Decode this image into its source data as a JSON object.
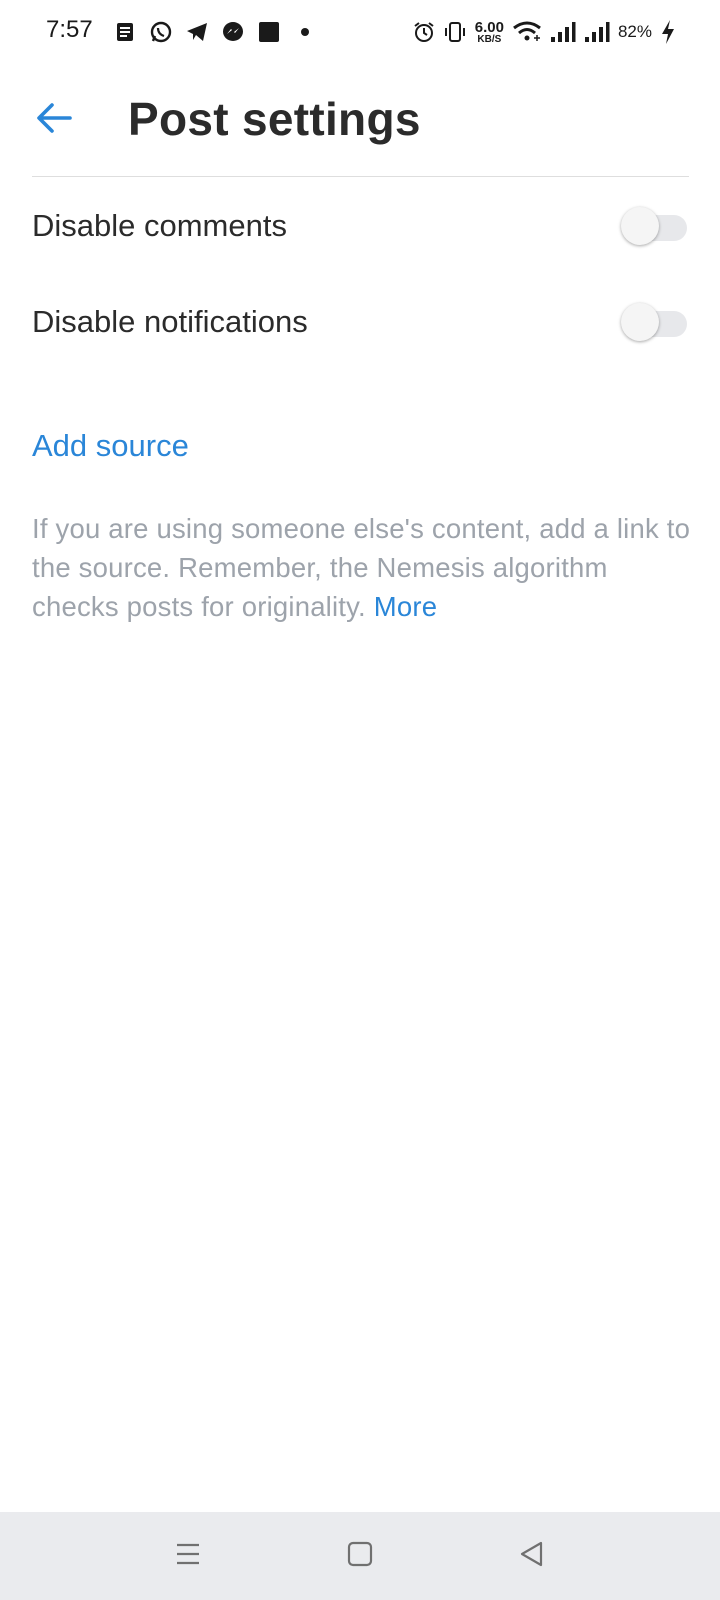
{
  "status_bar": {
    "time": "7:57",
    "notification_icons": [
      "news-icon",
      "whatsapp-icon",
      "telegram-icon",
      "messenger-icon",
      "square-app-icon",
      "dot-icon"
    ],
    "net_speed_value": "6.00",
    "net_speed_unit": "KB/S",
    "battery": "82%"
  },
  "header": {
    "title": "Post settings",
    "back_icon": "arrow-left-icon"
  },
  "settings": [
    {
      "label": "Disable comments",
      "enabled": false
    },
    {
      "label": "Disable notifications",
      "enabled": false
    }
  ],
  "source": {
    "add_label": "Add source",
    "help_text": "If you are using someone else's content, add a link to the source. Remember, the Nemesis algorithm checks posts for originality.",
    "more_label": "More"
  },
  "nav_bar": {
    "icons": [
      "menu-icon",
      "home-square-icon",
      "back-triangle-icon"
    ]
  },
  "colors": {
    "accent": "#2a86d8",
    "title": "#2b2b2b",
    "muted_text": "#9da3ab",
    "nav_bar_bg": "#eaebee"
  }
}
